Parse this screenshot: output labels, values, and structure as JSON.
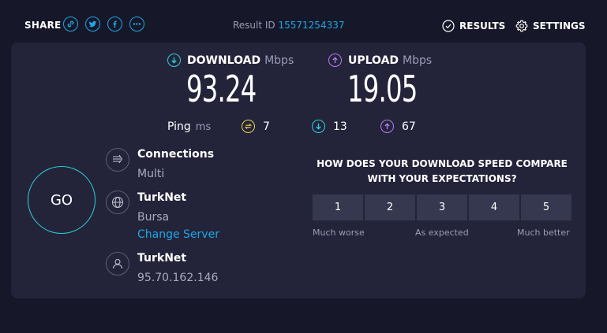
{
  "header": {
    "share_label": "SHARE",
    "result_id_label": "Result ID",
    "result_id_value": "15571254337",
    "results_label": "RESULTS",
    "settings_label": "SETTINGS"
  },
  "download": {
    "label": "DOWNLOAD",
    "unit": "Mbps",
    "value": "93.24"
  },
  "upload": {
    "label": "UPLOAD",
    "unit": "Mbps",
    "value": "19.05"
  },
  "ping": {
    "label": "Ping",
    "unit": "ms",
    "idle": "7",
    "download": "13",
    "upload": "67"
  },
  "go_label": "GO",
  "connections": {
    "title": "Connections",
    "value": "Multi"
  },
  "server": {
    "title": "TurkNet",
    "location": "Bursa",
    "change_label": "Change Server"
  },
  "provider": {
    "title": "TurkNet",
    "ip": "95.70.162.146"
  },
  "survey": {
    "question_line1": "HOW DOES YOUR DOWNLOAD SPEED COMPARE",
    "question_line2": "WITH YOUR EXPECTATIONS?",
    "options": [
      "1",
      "2",
      "3",
      "4",
      "5"
    ],
    "low_label": "Much worse",
    "mid_label": "As expected",
    "high_label": "Much better"
  },
  "colors": {
    "background": "#161728",
    "panel": "#23243a",
    "accent_blue": "#1ea7e8",
    "download_cyan": "#2fd1d6",
    "upload_purple": "#b57cf0",
    "ping_yellow": "#e8d34a"
  }
}
